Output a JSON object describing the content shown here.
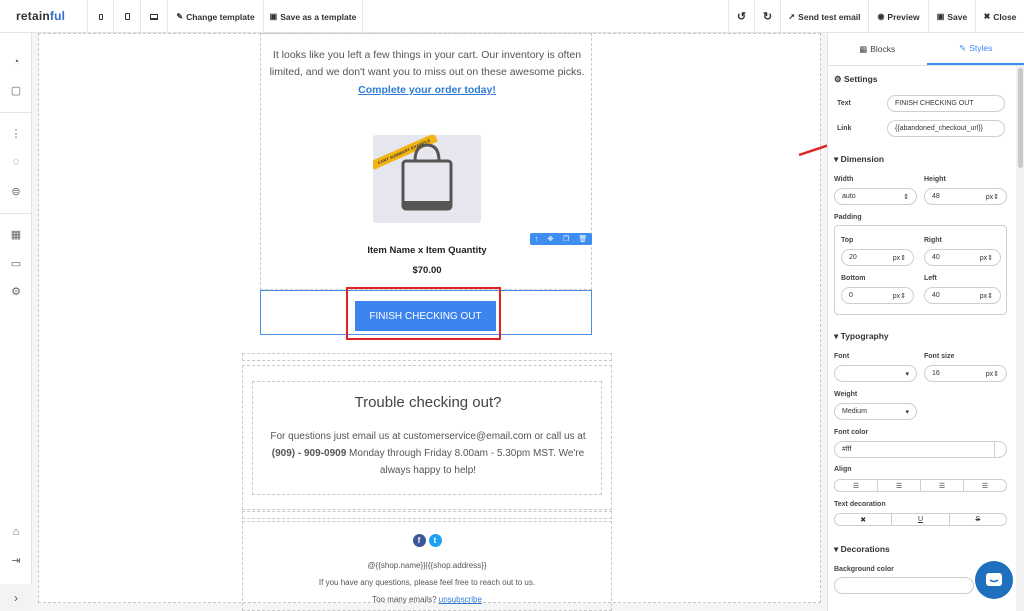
{
  "app": {
    "logo_text": "retain",
    "logo_accent": "ful"
  },
  "toolbar": {
    "change_template": "Change template",
    "save_as_template": "Save as a template",
    "send_test_email": "Send test email",
    "preview": "Preview",
    "save": "Save",
    "close": "Close"
  },
  "email": {
    "intro_text": "It looks like you left a few things in your cart. Our inventory is often limited, and we don't want you to miss out on these awesome picks.",
    "complete_order_link": "Complete your order today!",
    "ribbon_text": "CART SUMMARY EXAMPLE",
    "item_name": "Item Name x Item Quantity",
    "price": "$70.00",
    "checkout_button": "FINISH CHECKING OUT",
    "trouble_title": "Trouble checking out?",
    "trouble_text_1": "For questions just email us at customerservice@email.com or call us at",
    "trouble_phone": "(909) - 909-0909",
    "trouble_text_2": "Monday through Friday 8.00am - 5.30pm MST. We're always happy to help!",
    "social": [
      "f",
      "t"
    ],
    "footer_address": "@{{shop.name}}|{{shop.address}}",
    "footer_questions": "If you have any questions, please feel free to reach out to us.",
    "footer_too_many": "Too many emails?",
    "footer_unsubscribe": "unsubscribe"
  },
  "panel": {
    "tabs": [
      "Blocks",
      "Styles"
    ],
    "active_tab": "Styles",
    "settings": {
      "title": "Settings",
      "text_label": "Text",
      "text_value": "FINISH CHECKING OUT",
      "link_label": "Link",
      "link_value": "{{abandoned_checkout_url}}"
    },
    "dimension": {
      "title": "Dimension",
      "width_label": "Width",
      "width_value": "auto",
      "height_label": "Height",
      "height_value": "48",
      "height_unit": "px"
    },
    "padding": {
      "title": "Padding",
      "top_label": "Top",
      "top_value": "20",
      "right_label": "Right",
      "right_value": "40",
      "bottom_label": "Bottom",
      "bottom_value": "0",
      "left_label": "Left",
      "left_value": "40",
      "unit": "px"
    },
    "typography": {
      "title": "Typography",
      "font_label": "Font",
      "font_value": "",
      "font_size_label": "Font size",
      "font_size_value": "16",
      "font_size_unit": "px",
      "weight_label": "Weight",
      "weight_value": "Medium",
      "font_color_label": "Font color",
      "font_color_value": "#fff",
      "align_label": "Align",
      "text_decoration_label": "Text decoration",
      "decoration_options": [
        "✖",
        "U",
        "S"
      ]
    },
    "decorations": {
      "title": "Decorations",
      "bg_color_label": "Background color"
    }
  },
  "colors": {
    "accent": "#3e8df0",
    "button": "#3e84ef",
    "highlight": "#e02222",
    "chat": "#1e70bd"
  }
}
